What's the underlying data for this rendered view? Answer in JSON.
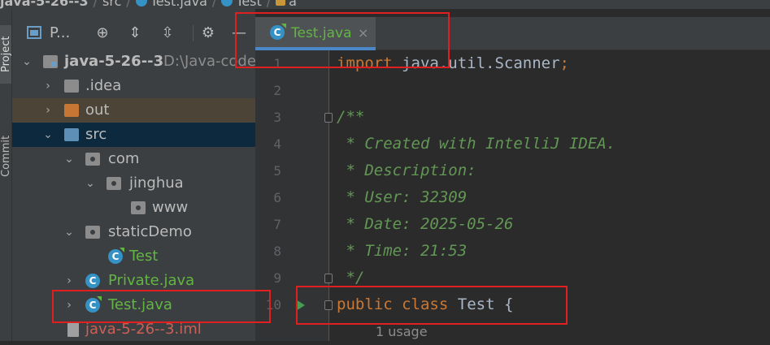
{
  "breadcrumb": {
    "project": "java-5-26--3",
    "src": "src",
    "file": "Test.java",
    "class": "Test",
    "member": "a"
  },
  "tool_strip": {
    "project_tab": "Project",
    "commit_tab": "Commit"
  },
  "project_panel": {
    "title": "P...",
    "icons": [
      "window-icon",
      "crosshair-icon",
      "expand-all-icon",
      "collapse-all-icon",
      "gear-icon",
      "minimize-icon"
    ],
    "tree": [
      {
        "label": "java-5-26--3",
        "path": "D:\\Java-code\\",
        "kind": "module",
        "expanded": true
      },
      {
        "label": ".idea",
        "kind": "folder",
        "expanded": false
      },
      {
        "label": "out",
        "kind": "folder-orange",
        "expanded": false
      },
      {
        "label": "src",
        "kind": "folder-blue",
        "expanded": true
      },
      {
        "label": "com",
        "kind": "package",
        "expanded": true
      },
      {
        "label": "jinghua",
        "kind": "package",
        "expanded": true
      },
      {
        "label": "www",
        "kind": "package"
      },
      {
        "label": "staticDemo",
        "kind": "package",
        "expanded": true
      },
      {
        "label": "Test",
        "kind": "class"
      },
      {
        "label": "Private.java",
        "kind": "class-file",
        "expanded": false
      },
      {
        "label": "Test.java",
        "kind": "class-file",
        "expanded": false
      },
      {
        "label": "java-5-26--3.iml",
        "kind": "iml"
      }
    ]
  },
  "editor": {
    "tab": {
      "label": "Test.java",
      "close": "×"
    },
    "lines": [
      {
        "n": "1",
        "import_kw": "import",
        "text": " java.util.Scanner",
        "semi": ";"
      },
      {
        "n": "2"
      },
      {
        "n": "3",
        "doc": "/**"
      },
      {
        "n": "4",
        "doc": " * Created with IntelliJ IDEA."
      },
      {
        "n": "5",
        "doc": " * Description:"
      },
      {
        "n": "6",
        "doc": " * User: 32309"
      },
      {
        "n": "7",
        "doc": " * Date: 2025-05-26"
      },
      {
        "n": "8",
        "doc": " * Time: 21:53"
      },
      {
        "n": "9",
        "doc": " */"
      },
      {
        "n": "10",
        "kw1": "public",
        "kw2": "class",
        "name": "Test",
        "brace": "{"
      }
    ],
    "usage_hint": "1 usage"
  },
  "colors": {
    "annotation_red": "#e02020",
    "keyword": "#cc7832",
    "doc_comment": "#629755",
    "class_file_green": "#62b543",
    "selection_blue": "#0d293e"
  }
}
